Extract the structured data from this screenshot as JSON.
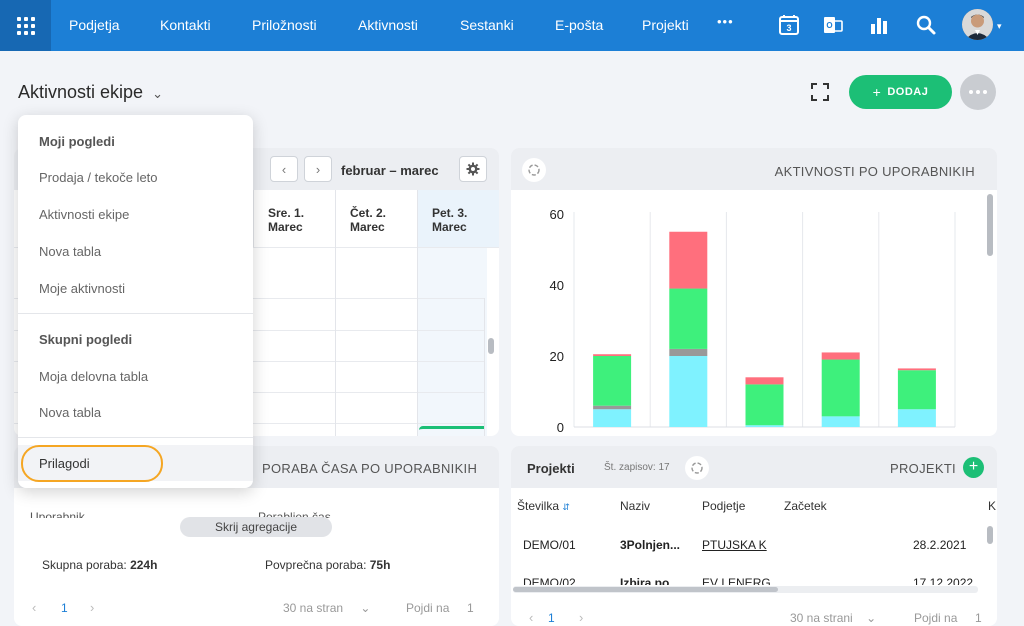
{
  "nav": {
    "items": [
      "Podjetja",
      "Kontakti",
      "Priložnosti",
      "Aktivnosti",
      "Sestanki",
      "E-pošta",
      "Projekti"
    ],
    "more": "•••",
    "calendar_day": "3"
  },
  "header": {
    "title": "Aktivnosti ekipe",
    "add_label": "DODAJ",
    "add_icon": "+"
  },
  "dropdown": {
    "my_views_heading": "Moji pogledi",
    "my_views": [
      "Prodaja / tekoče leto",
      "Aktivnosti ekipe",
      "Nova tabla",
      "Moje aktivnosti"
    ],
    "group_views_heading": "Skupni pogledi",
    "group_views": [
      "Moja delovna tabla",
      "Nova tabla"
    ],
    "customize": "Prilagodi"
  },
  "calendar": {
    "range": "februar – marec",
    "prev": "‹",
    "next": "›",
    "columns": [
      {
        "day": "Sre. 1.",
        "month": "Marec"
      },
      {
        "day": "Čet. 2.",
        "month": "Marec"
      },
      {
        "day": "Pet. 3.",
        "month": "Marec"
      }
    ]
  },
  "chart_data": {
    "type": "bar",
    "title": "AKTIVNOSTI PO UPORABNIKIH",
    "ylim": [
      0,
      60
    ],
    "yticks": [
      "60",
      "40",
      "20",
      "0"
    ],
    "categories": [
      "",
      "",
      "",
      "",
      ""
    ],
    "series": [
      {
        "color": "#7ff2ff",
        "values": [
          5,
          20,
          0.5,
          3,
          5
        ]
      },
      {
        "color": "#999999",
        "values": [
          1,
          2,
          0,
          0,
          0
        ]
      },
      {
        "color": "#3ef07c",
        "values": [
          14,
          17,
          11.5,
          16,
          11
        ]
      },
      {
        "color": "#ff6f7d",
        "values": [
          0.5,
          16,
          2,
          2,
          0.5
        ]
      }
    ]
  },
  "usage": {
    "title": "PORABA ČASA PO UPORABNIKIH",
    "col1": "Uporabnik",
    "col2": "Porabljen čas",
    "hide_label": "Skrij agregacije",
    "total_label": "Skupna poraba:",
    "total_value": "224h",
    "avg_label": "Povprečna poraba:",
    "avg_value": "75h",
    "page": "1",
    "per_page": "30 na stran",
    "goto": "Pojdi na",
    "goto_page": "1"
  },
  "projects": {
    "title": "Projekti",
    "count": "Št. zapisov: 17",
    "section": "PROJEKTI",
    "columns": [
      "Številka",
      "Naziv",
      "Podjetje",
      "Začetek",
      "K"
    ],
    "rows": [
      {
        "number": "DEMO/01",
        "name": "3Polnjen...",
        "company": "PTUJSKA K",
        "start": "28.2.2021"
      },
      {
        "number": "DEMO/02",
        "name": "Izbira po...",
        "company": "EV LENERG",
        "start": "17.12.2022"
      }
    ],
    "page": "1",
    "per_page": "30 na strani",
    "goto": "Pojdi na",
    "goto_page": "1"
  },
  "colors": {
    "nav": "#1c7fd6",
    "accent_green": "#1cbf76",
    "highlight_ring": "#f5a623"
  }
}
